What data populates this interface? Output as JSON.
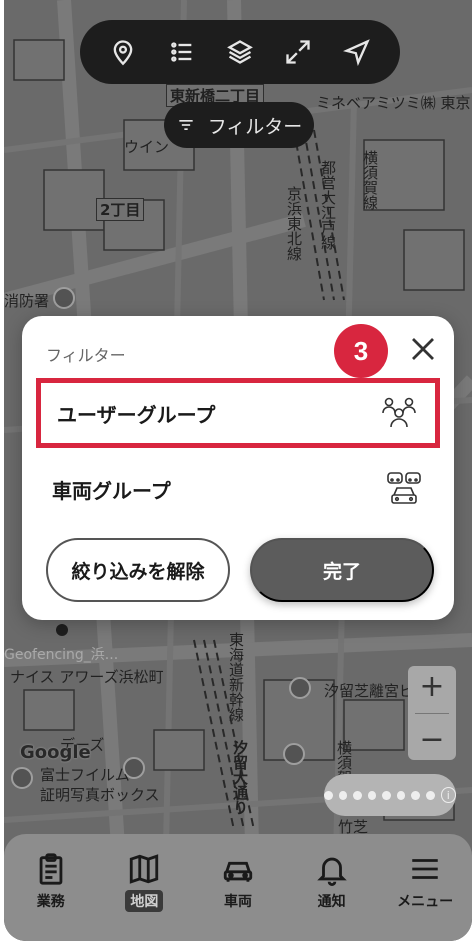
{
  "toolbar": {
    "icons": [
      "location-pin-icon",
      "list-icon",
      "layers-icon",
      "expand-icon",
      "navigate-arrow-icon"
    ],
    "filter_label": "フィルター"
  },
  "map": {
    "labels": {
      "l1": "東新橋二丁目",
      "l2": "ミネベアミツミ㈱ 東京",
      "l3": "ウイン",
      "l4": "2丁目",
      "l5": "消防署",
      "l6": "都営大江戸線",
      "l7": "京浜東北線",
      "l8": "横須賀線",
      "l9": "Geofencing_浜...",
      "l10": "ナイス アワーズ浜松町",
      "l11": "東海道新幹線",
      "l12": "汐留芝離宮ビ",
      "l13": "デーズ",
      "l14": "富士フイルム",
      "l15": "証明写真ボックス",
      "l16": "汐留大通り",
      "l17": "竹芝",
      "l18": "横須賀線"
    },
    "google": "Google",
    "zoom_in": "+",
    "zoom_out": "−",
    "scale_info": "i"
  },
  "modal": {
    "title": "フィルター",
    "step_badge": "3",
    "options": [
      {
        "label": "ユーザーグループ",
        "icon": "user-group-icon",
        "highlighted": true
      },
      {
        "label": "車両グループ",
        "icon": "vehicle-group-icon",
        "highlighted": false
      }
    ],
    "clear_label": "絞り込みを解除",
    "done_label": "完了"
  },
  "bottom_nav": [
    {
      "label": "業務",
      "icon": "clipboard-icon",
      "active": false
    },
    {
      "label": "地図",
      "icon": "map-icon",
      "active": true
    },
    {
      "label": "車両",
      "icon": "car-icon",
      "active": false
    },
    {
      "label": "通知",
      "icon": "bell-icon",
      "active": false
    },
    {
      "label": "メニュー",
      "icon": "menu-icon",
      "active": false
    }
  ],
  "colors": {
    "accent": "#d8263f",
    "toolbar_bg": "#1d1d1d",
    "done_button": "#5c5c5c"
  }
}
